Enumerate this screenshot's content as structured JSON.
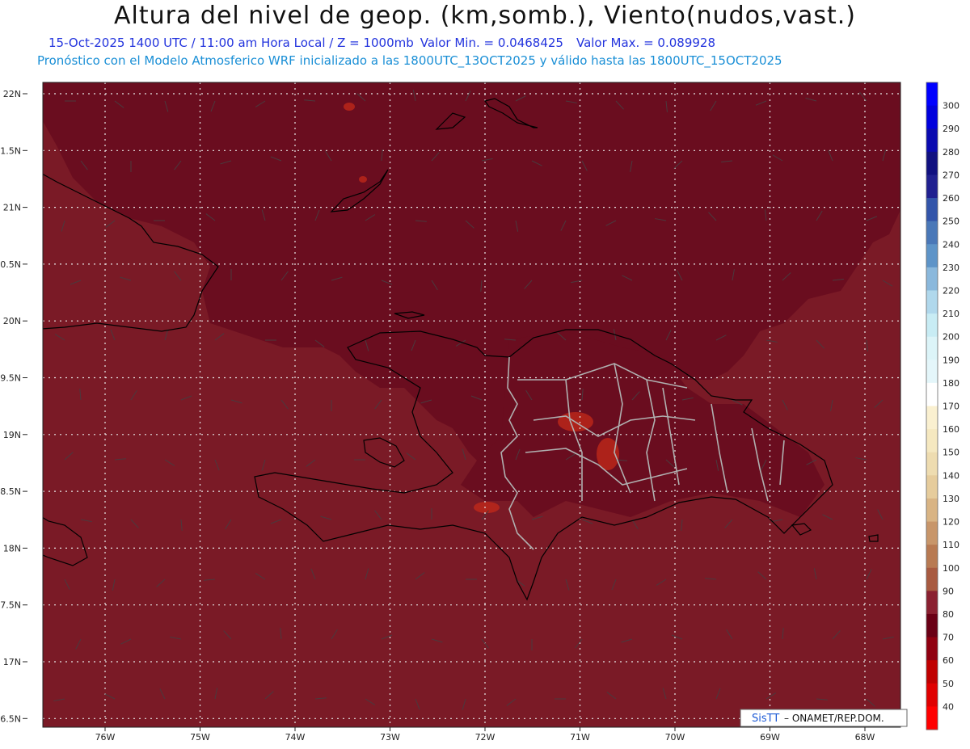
{
  "header": {
    "title": "Altura del nivel de geop. (km,somb.), Viento(nudos,vast.)",
    "datetime": "15-Oct-2025 1400 UTC / 11:00 am Hora Local / Z = 1000mb",
    "min_value": "Valor Min. = 0.0468425",
    "max_value": "Valor Max. = 0.089928",
    "model_info": "Pronóstico con el Modelo Atmosferico WRF inicializado a las 1800UTC_13OCT2025 y válido hasta las  1800UTC_15OCT2025"
  },
  "map": {
    "lat_labels": [
      "22N",
      "1.5N",
      "21N",
      "0.5N",
      "20N",
      "9.5N",
      "19N",
      "8.5N",
      "18N",
      "7.5N",
      "17N",
      "6.5N"
    ],
    "lon_labels": [
      "76W",
      "75W",
      "74W",
      "73W",
      "72W",
      "71W",
      "70W",
      "69W",
      "68W"
    ],
    "colors": {
      "background_field": "#7a1a26",
      "high_field": "#6a0d1f",
      "hotspot": "#c42a1a",
      "coastline": "#000000",
      "borders": "#b0b0b0"
    }
  },
  "colorbar": {
    "labels": [
      "300",
      "290",
      "280",
      "270",
      "260",
      "250",
      "240",
      "230",
      "220",
      "210",
      "200",
      "190",
      "180",
      "170",
      "160",
      "150",
      "140",
      "130",
      "120",
      "110",
      "100",
      "90",
      "80",
      "70",
      "60",
      "50",
      "40"
    ],
    "colors": [
      "#0000ff",
      "#0000dd",
      "#0a0ab0",
      "#101080",
      "#202090",
      "#3355aa",
      "#4a78b8",
      "#5e94c8",
      "#8ab8dc",
      "#b0d8ec",
      "#c8ecf4",
      "#dcf4f8",
      "#e4f6fa",
      "#ffffff",
      "#faf0d0",
      "#f5e8c0",
      "#eedcb0",
      "#e6cc9c",
      "#d9b484",
      "#c8966a",
      "#b87a52",
      "#a85a40",
      "#8a2030",
      "#6a0015",
      "#900010",
      "#c00000",
      "#e00000",
      "#ff0000"
    ]
  },
  "credit": {
    "brand": "SisTT",
    "org": " – ONAMET/REP.DOM."
  }
}
